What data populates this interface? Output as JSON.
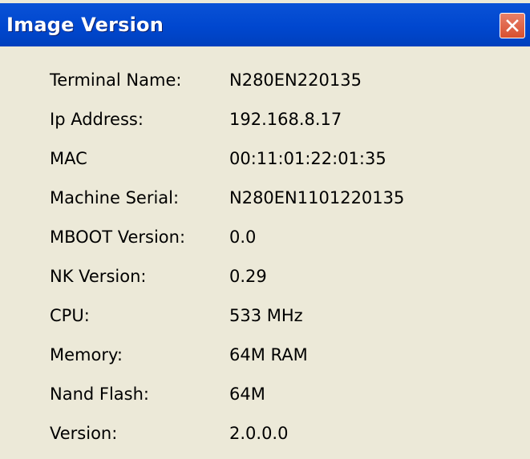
{
  "window": {
    "title": "Image Version",
    "close_icon": "close-icon"
  },
  "info": {
    "rows": [
      {
        "label": "Terminal Name:",
        "value": "N280EN220135"
      },
      {
        "label": "Ip Address:",
        "value": "192.168.8.17"
      },
      {
        "label": "MAC",
        "value": "00:11:01:22:01:35"
      },
      {
        "label": "Machine Serial:",
        "value": "N280EN1101220135"
      },
      {
        "label": "MBOOT Version:",
        "value": "0.0"
      },
      {
        "label": "NK Version:",
        "value": "0.29"
      },
      {
        "label": "CPU:",
        "value": "533 MHz"
      },
      {
        "label": "Memory:",
        "value": "64M RAM"
      },
      {
        "label": "Nand Flash:",
        "value": "64M"
      },
      {
        "label": "Version:",
        "value": "2.0.0.0"
      }
    ]
  },
  "colors": {
    "titlebar": "#0047cf",
    "background": "#ece9d8",
    "close_button": "#d8502f"
  }
}
